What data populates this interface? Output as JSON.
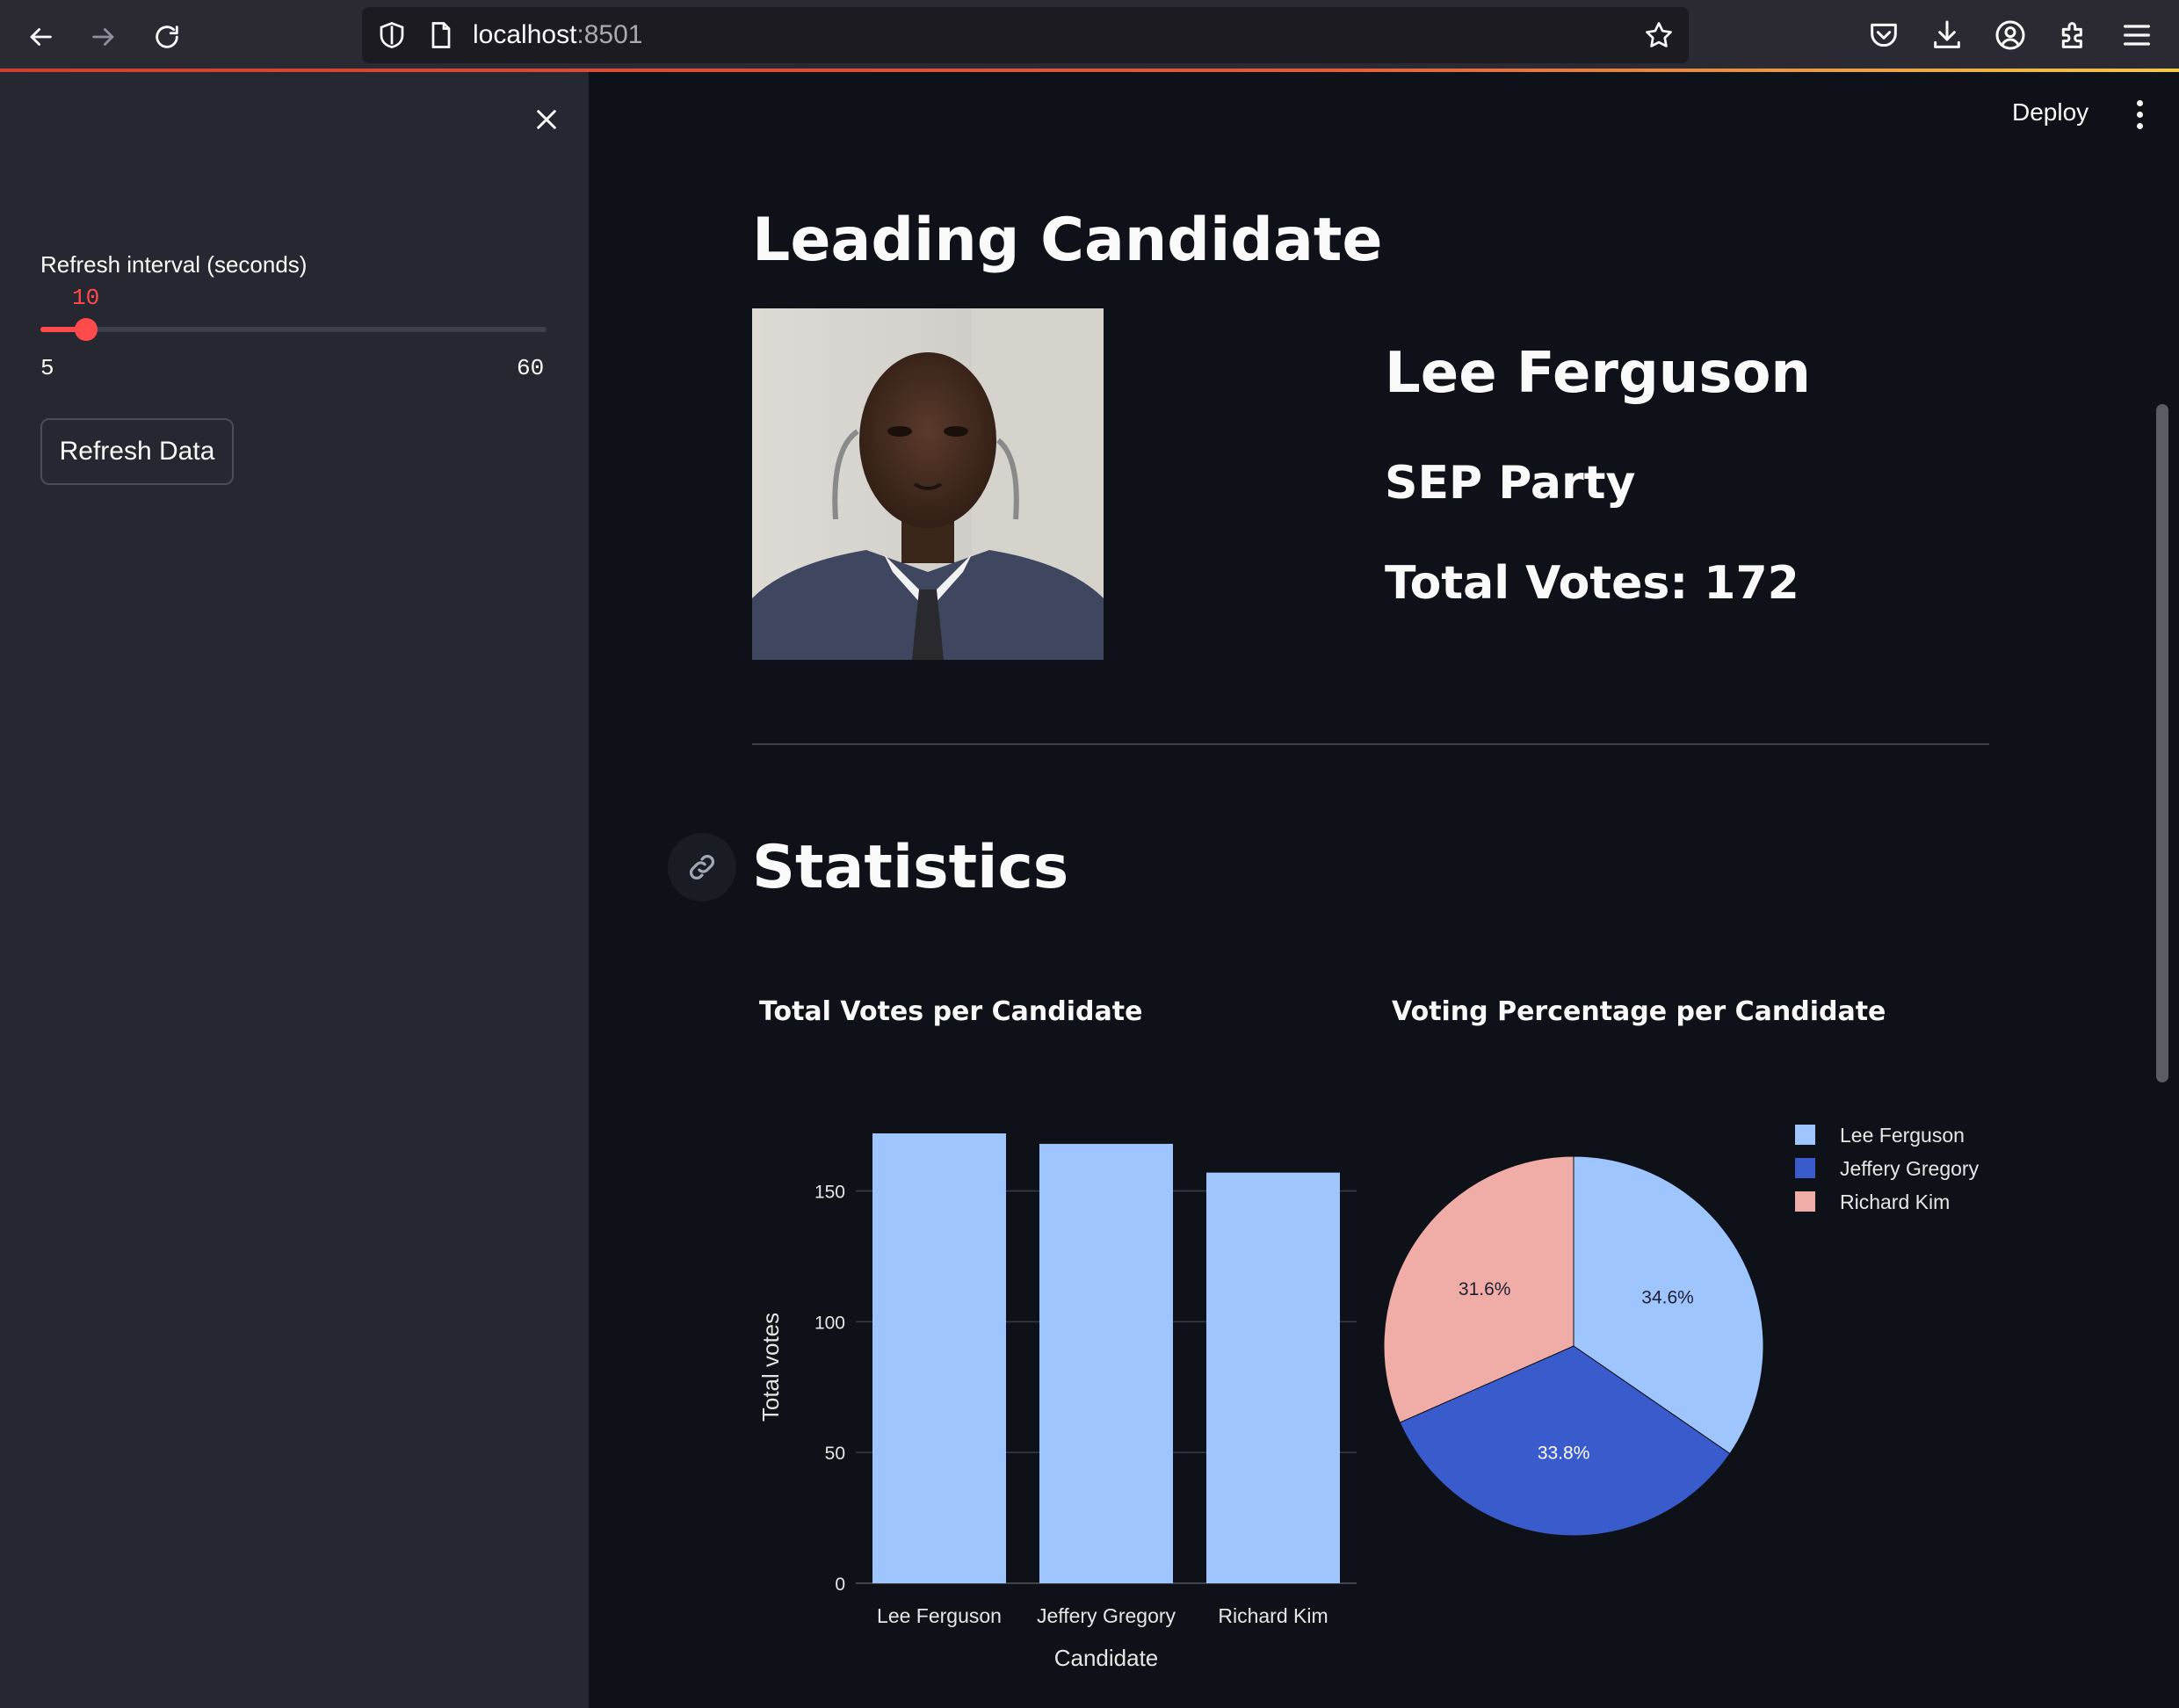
{
  "browser": {
    "url_host": "localhost",
    "url_port": ":8501"
  },
  "sidebar": {
    "slider_label": "Refresh interval (seconds)",
    "slider_value": "10",
    "slider_min": "5",
    "slider_max": "60",
    "refresh_button": "Refresh Data"
  },
  "header": {
    "deploy_label": "Deploy"
  },
  "leading": {
    "heading": "Leading Candidate",
    "name": "Lee Ferguson",
    "party": "SEP Party",
    "votes_text": "Total Votes: 172"
  },
  "statistics": {
    "heading": "Statistics"
  },
  "colors": {
    "accent": "#ff4b4b",
    "bar": "#9ec5fe",
    "pie_lee": "#9ec5fe",
    "pie_jeffery": "#3a5bcc",
    "pie_richard": "#f0ada8"
  },
  "chart_data": [
    {
      "type": "bar",
      "title": "Total Votes per Candidate",
      "xlabel": "Candidate",
      "ylabel": "Total votes",
      "categories": [
        "Lee Ferguson",
        "Jeffery Gregory",
        "Richard Kim"
      ],
      "values": [
        172,
        168,
        157
      ],
      "ylim": [
        0,
        172
      ],
      "yticks": [
        0,
        50,
        100,
        150
      ],
      "grid": true
    },
    {
      "type": "pie",
      "title": "Voting Percentage per Candidate",
      "labels": [
        "Lee Ferguson",
        "Jeffery Gregory",
        "Richard Kim"
      ],
      "values": [
        34.6,
        33.8,
        31.6
      ],
      "value_labels": [
        "34.6%",
        "33.8%",
        "31.6%"
      ],
      "legend": "top-right"
    }
  ]
}
